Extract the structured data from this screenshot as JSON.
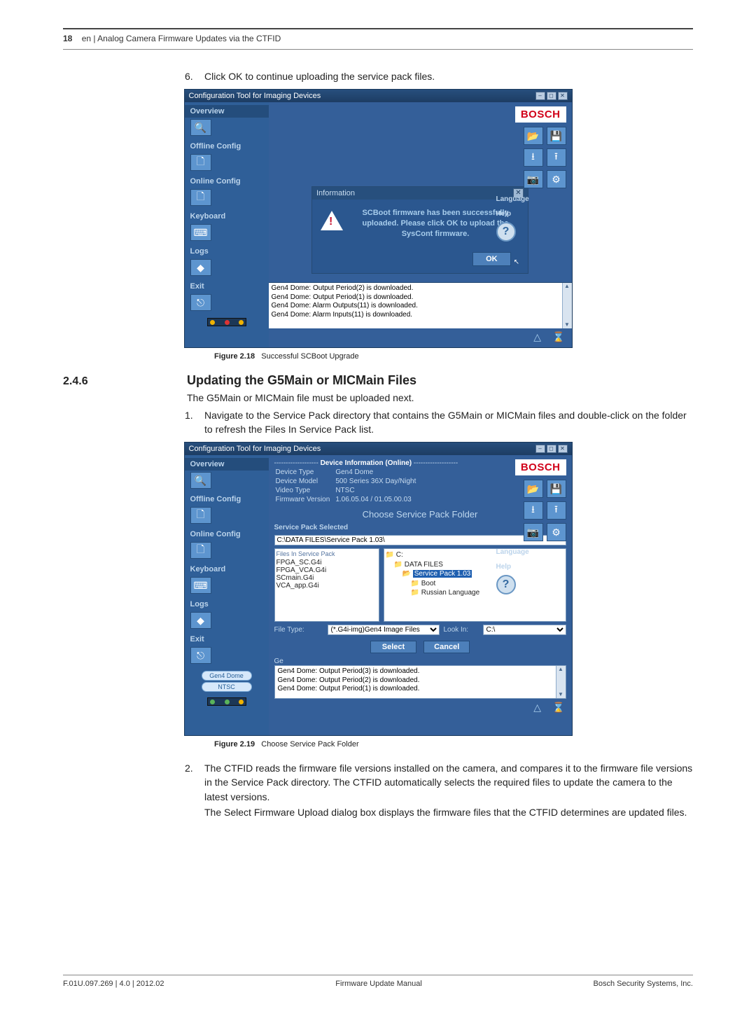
{
  "header": {
    "page_number": "18",
    "running_head": "en | Analog Camera Firmware Updates via the CTFID"
  },
  "step6": {
    "num": "6.",
    "text": "Click OK to continue uploading the service pack files."
  },
  "fig218": {
    "label": "Figure 2.18",
    "caption": "Successful SCBoot Upgrade"
  },
  "sec246": {
    "num": "2.4.6",
    "title": "Updating the G5Main or MICMain Files",
    "intro": "The G5Main or MICMain file must be uploaded next.",
    "step1_num": "1.",
    "step1": "Navigate to the Service Pack directory that contains the G5Main or MICMain files and double-click on the folder to refresh the Files In Service Pack list."
  },
  "fig219": {
    "label": "Figure 2.19",
    "caption": "Choose Service Pack Folder"
  },
  "step2": {
    "num": "2.",
    "text_a": "The CTFID reads the firmware file versions installed on the camera, and compares it to the firmware file versions in the Service Pack directory. The CTFID automatically selects the required files to update the camera to the latest versions.",
    "text_b": "The Select Firmware Upload dialog box displays the firmware files that the CTFID determines are updated files."
  },
  "footer": {
    "left": "F.01U.097.269 | 4.0 | 2012.02",
    "center": "Firmware Update Manual",
    "right": "Bosch Security Systems, Inc."
  },
  "ctfid": {
    "title": "Configuration Tool for Imaging Devices",
    "nav": {
      "overview": "Overview",
      "offline": "Offline Config",
      "online": "Online Config",
      "keyboard": "Keyboard",
      "logs": "Logs",
      "exit": "Exit"
    },
    "side": {
      "language": "Language",
      "help": "Help"
    },
    "bosch": "BOSCH",
    "info_dialog": {
      "title": "Information",
      "msg1": "SCBoot firmware has been successfully uploaded.  Please click OK to upload the SysCont firmware.",
      "ok": "OK"
    },
    "log1": [
      "Gen4 Dome: Output Period(2) is downloaded.",
      "Gen4 Dome: Output Period(1) is downloaded.",
      "Gen4 Dome: Alarm Outputs(11) is downloaded.",
      "Gen4 Dome: Alarm Inputs(11) is downloaded."
    ],
    "device_info": {
      "header": "Device Information (Online)",
      "rows": {
        "type_l": "Device Type",
        "type_v": "Gen4 Dome",
        "model_l": "Device Model",
        "model_v": "500 Series 36X Day/Night",
        "video_l": "Video Type",
        "video_v": "NTSC",
        "fw_l": "Firmware Version",
        "fw_v": "1.06.05.04 / 01.05.00.03"
      }
    },
    "svc": {
      "folder_hd": "Choose Service Pack Folder",
      "selected_lbl": "Service Pack Selected",
      "path": "C:\\DATA FILES\\Service Pack 1.03\\",
      "files_lbl": "Files In Service Pack",
      "files": [
        "FPGA_SC.G4i",
        "FPGA_VCA.G4i",
        "SCmain.G4i",
        "VCA_app.G4i"
      ],
      "tree": {
        "c": "C:",
        "data": "DATA FILES",
        "sp": "Service Pack 1.03",
        "boot": "Boot",
        "rus": "Russian Language"
      },
      "file_type_lbl": "File Type:",
      "file_type_val": "(*.G4i-img)Gen4 Image Files",
      "lookin_lbl": "Look In:",
      "lookin_val": "C:\\",
      "select": "Select",
      "cancel": "Cancel"
    },
    "badges": {
      "gen4": "Gen4 Dome",
      "ntsc": "NTSC"
    },
    "log2": [
      "Gen4 Dome: Output Period(3) is downloaded.",
      "Gen4 Dome: Output Period(2) is downloaded.",
      "Gen4 Dome: Output Period(1) is downloaded."
    ]
  }
}
